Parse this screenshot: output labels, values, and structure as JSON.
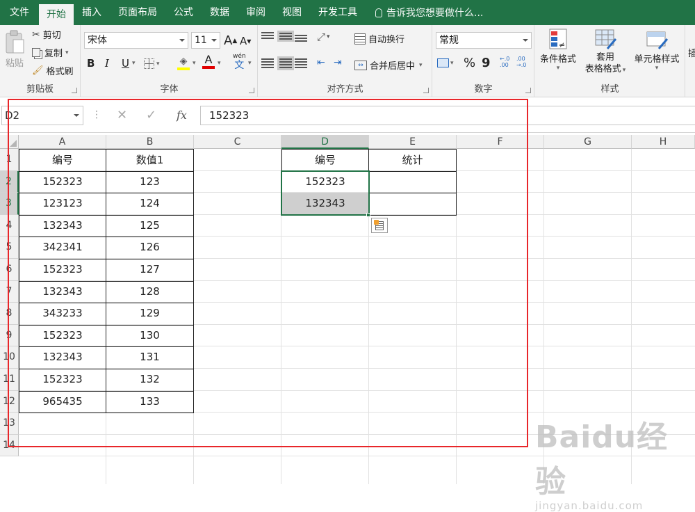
{
  "menubar": {
    "tabs": [
      "文件",
      "开始",
      "插入",
      "页面布局",
      "公式",
      "数据",
      "审阅",
      "视图",
      "开发工具"
    ],
    "active_tab": "开始",
    "tellme": "告诉我您想要做什么..."
  },
  "ribbon": {
    "clipboard": {
      "label": "剪贴板",
      "paste": "粘贴",
      "cut": "剪切",
      "copy": "复制",
      "format_painter": "格式刷"
    },
    "font": {
      "label": "字体",
      "font_name": "宋体",
      "font_size": "11",
      "bold": "B",
      "italic": "I",
      "underline": "U",
      "grow": "A",
      "shrink": "A",
      "font_color_glyph": "A",
      "phonetic": "wén",
      "phonetic_char": "文"
    },
    "alignment": {
      "label": "对齐方式",
      "wrap": "自动换行",
      "merge": "合并后居中"
    },
    "number": {
      "label": "数字",
      "format": "常规",
      "percent": "%",
      "comma": "9",
      "inc_decimal": "←.0 .00",
      "dec_decimal": ".00 →.0"
    },
    "styles": {
      "label": "样式",
      "conditional": "条件格式",
      "table_line1": "套用",
      "table_line2": "表格格式",
      "cell_styles": "单元格样式"
    },
    "cells_partial": "插"
  },
  "formula_bar": {
    "name_box": "D2",
    "fx": "fx",
    "cancel": "✕",
    "enter": "✓",
    "formula": "152323"
  },
  "sheet": {
    "columns": [
      "A",
      "B",
      "C",
      "D",
      "E",
      "F",
      "G",
      "H"
    ],
    "rows": [
      "1",
      "2",
      "3",
      "4",
      "5",
      "6",
      "7",
      "8",
      "9",
      "10",
      "11",
      "12",
      "13",
      "14"
    ],
    "selected_column": "D",
    "selected_rows": [
      "2",
      "3"
    ],
    "table1": {
      "headers": [
        "编号",
        "数值1"
      ],
      "rows": [
        [
          "152323",
          "123"
        ],
        [
          "123123",
          "124"
        ],
        [
          "132343",
          "125"
        ],
        [
          "342341",
          "126"
        ],
        [
          "152323",
          "127"
        ],
        [
          "132343",
          "128"
        ],
        [
          "343233",
          "129"
        ],
        [
          "152323",
          "130"
        ],
        [
          "132343",
          "131"
        ],
        [
          "152323",
          "132"
        ],
        [
          "965435",
          "133"
        ]
      ]
    },
    "table2": {
      "headers": [
        "编号",
        "统计"
      ],
      "rows": [
        [
          "152323",
          ""
        ],
        [
          "132343",
          ""
        ]
      ]
    }
  },
  "watermark": {
    "brand": "Baidu经验",
    "url": "jingyan.baidu.com"
  },
  "colors": {
    "excel_green": "#217346",
    "annotation_red": "#e8262a",
    "selection_gray": "#cfcfcf"
  }
}
